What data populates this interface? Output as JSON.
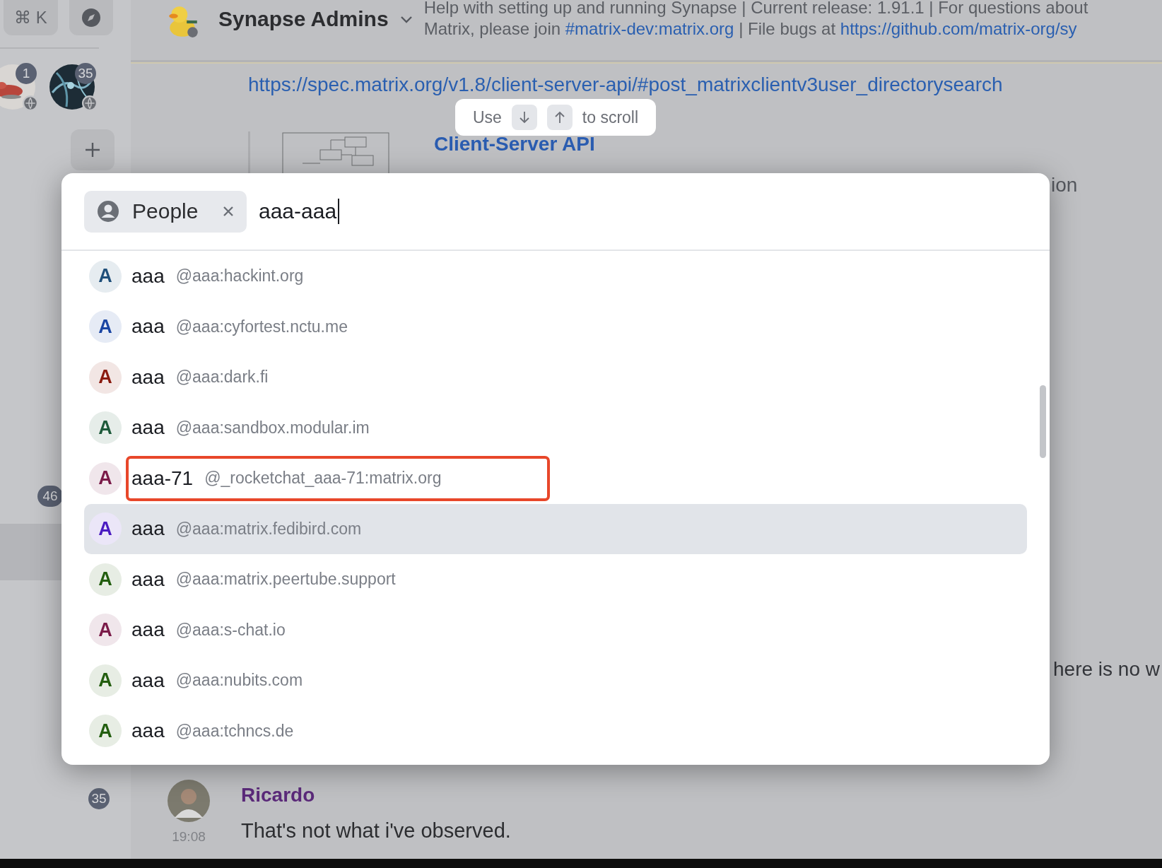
{
  "space_bar": {
    "shortcut": "⌘ K",
    "spaces": [
      {
        "kind": "picture",
        "badge": "1"
      },
      {
        "kind": "picture",
        "badge": "35"
      }
    ]
  },
  "rooms": [
    {
      "badge": "46",
      "selected": false
    },
    {
      "selected": true
    },
    {
      "badge": "35",
      "selected": false
    }
  ],
  "room_header": {
    "name": "Synapse Admins",
    "topic": [
      [
        {
          "kind": "text",
          "text": "Help with setting up and running Synapse | Current release: 1.91.1 | For questions about"
        }
      ],
      [
        {
          "kind": "text",
          "text": "Matrix, please join "
        },
        {
          "kind": "link",
          "text": "#matrix-dev:matrix.org"
        },
        {
          "kind": "text",
          "text": " | File bugs at "
        },
        {
          "kind": "link",
          "text": "https://github.com/matrix-org/sy"
        }
      ]
    ]
  },
  "timeline": {
    "link": "https://spec.matrix.org/v1.8/client-server-api/#post_matrixclientv3user_directorysearch",
    "preview_title": "Client-Server API",
    "preview_tail": "ion",
    "message_tail": "here is no w",
    "message": {
      "sender": "Ricardo",
      "time": "19:08",
      "body": "That's not what i've observed."
    }
  },
  "scroll_hint": {
    "before": "Use",
    "after": "to scroll"
  },
  "dialog": {
    "filter": "People",
    "query": "aaa-aaa",
    "results": [
      {
        "initial": "A",
        "name": "aaa",
        "mxid": "@aaa:hackint.org",
        "color": "#1f4f7a",
        "selected": false,
        "annotated": false
      },
      {
        "initial": "A",
        "name": "aaa",
        "mxid": "@aaa:cyfortest.nctu.me",
        "color": "#1a45a3",
        "selected": false,
        "annotated": false
      },
      {
        "initial": "A",
        "name": "aaa",
        "mxid": "@aaa:dark.fi",
        "color": "#8a1a0e",
        "selected": false,
        "annotated": false
      },
      {
        "initial": "A",
        "name": "aaa",
        "mxid": "@aaa:sandbox.modular.im",
        "color": "#1d5a3a",
        "selected": false,
        "annotated": false
      },
      {
        "initial": "A",
        "name": "aaa-71",
        "mxid": "@_rocketchat_aaa-71:matrix.org",
        "color": "#7a1a48",
        "selected": false,
        "annotated": true
      },
      {
        "initial": "A",
        "name": "aaa",
        "mxid": "@aaa:matrix.fedibird.com",
        "color": "#4a1bc1",
        "selected": true,
        "annotated": false
      },
      {
        "initial": "A",
        "name": "aaa",
        "mxid": "@aaa:matrix.peertube.support",
        "color": "#225d0e",
        "selected": false,
        "annotated": false
      },
      {
        "initial": "A",
        "name": "aaa",
        "mxid": "@aaa:s-chat.io",
        "color": "#7a1a48",
        "selected": false,
        "annotated": false
      },
      {
        "initial": "A",
        "name": "aaa",
        "mxid": "@aaa:nubits.com",
        "color": "#225d0e",
        "selected": false,
        "annotated": false
      },
      {
        "initial": "A",
        "name": "aaa",
        "mxid": "@aaa:tchncs.de",
        "color": "#225d0e",
        "selected": false,
        "annotated": false
      }
    ]
  }
}
